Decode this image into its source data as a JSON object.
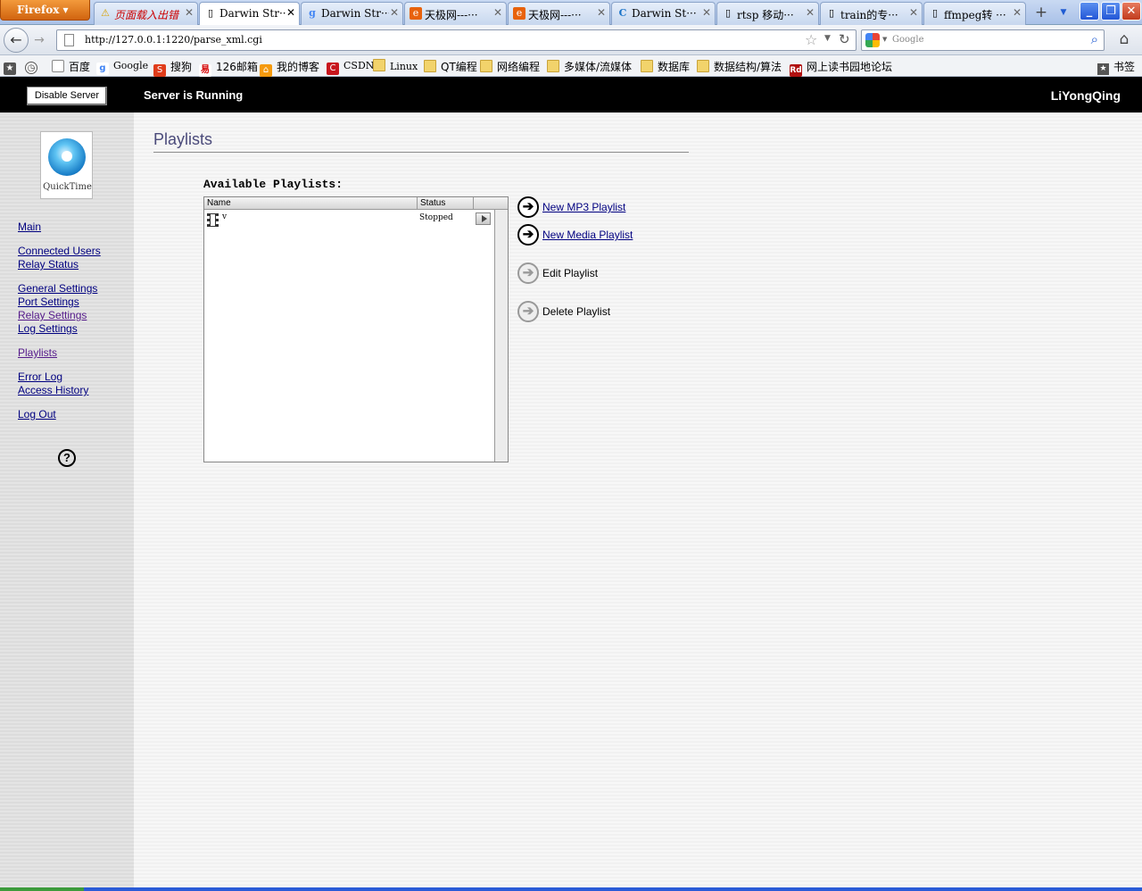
{
  "browser": {
    "menu_button": "Firefox",
    "tabs": [
      {
        "label": "页面载入出错",
        "icon": "warning-icon",
        "active": false
      },
      {
        "label": "Darwin Str···",
        "icon": "page-icon",
        "active": true
      },
      {
        "label": "Darwin Str···",
        "icon": "google-icon",
        "active": false
      },
      {
        "label": "天极网---···",
        "icon": "yesky-icon",
        "active": false
      },
      {
        "label": "天极网---···",
        "icon": "yesky-icon",
        "active": false
      },
      {
        "label": "Darwin  St···",
        "icon": "c-icon",
        "active": false
      },
      {
        "label": "rtsp 移动···",
        "icon": "page-icon",
        "active": false
      },
      {
        "label": "train的专···",
        "icon": "page-icon",
        "active": false
      },
      {
        "label": "ffmpeg转 ···",
        "icon": "page-icon",
        "active": false
      }
    ],
    "url": "http://127.0.0.1:1220/parse_xml.cgi",
    "search_placeholder": "Google",
    "bookmarks": [
      {
        "label": "百度",
        "icon": "page-icon"
      },
      {
        "label": "Google",
        "icon": "google-icon"
      },
      {
        "label": "搜狗",
        "icon": "sogou-icon"
      },
      {
        "label": "126邮箱",
        "icon": "mail-icon"
      },
      {
        "label": "我的博客",
        "icon": "blog-icon"
      },
      {
        "label": "CSDN",
        "icon": "csdn-icon"
      },
      {
        "label": "Linux",
        "icon": "folder-icon"
      },
      {
        "label": "QT编程",
        "icon": "folder-icon"
      },
      {
        "label": "网络编程",
        "icon": "folder-icon"
      },
      {
        "label": "多媒体/流媒体",
        "icon": "folder-icon"
      },
      {
        "label": "数据库",
        "icon": "folder-icon"
      },
      {
        "label": "数据结构/算法",
        "icon": "folder-icon"
      },
      {
        "label": "网上读书园地论坛",
        "icon": "rd-icon"
      }
    ],
    "bookmarks_menu": "书签"
  },
  "header": {
    "disable_button": "Disable Server",
    "status": "Server is Running",
    "user": "LiYongQing"
  },
  "sidebar": {
    "logo_text": "QuickTime",
    "nav": [
      {
        "label": "Main",
        "visited": false
      },
      {
        "label": "Connected Users",
        "visited": false
      },
      {
        "label": "Relay Status",
        "visited": false
      },
      {
        "label": "General Settings",
        "visited": false
      },
      {
        "label": "Port Settings",
        "visited": false
      },
      {
        "label": "Relay Settings",
        "visited": true
      },
      {
        "label": "Log Settings",
        "visited": false
      },
      {
        "label": "Playlists",
        "visited": true
      },
      {
        "label": "Error Log",
        "visited": false
      },
      {
        "label": "Access History",
        "visited": false
      },
      {
        "label": "Log Out",
        "visited": false
      }
    ],
    "help_icon": "?"
  },
  "main": {
    "title": "Playlists",
    "available_label": "Available Playlists:",
    "table": {
      "columns": [
        "Name",
        "Status"
      ],
      "rows": [
        {
          "name": "v",
          "status": "Stopped"
        }
      ]
    },
    "actions": [
      {
        "label": "New MP3 Playlist",
        "enabled": true
      },
      {
        "label": "New Media Playlist",
        "enabled": true
      },
      {
        "label": "Edit Playlist",
        "enabled": false
      },
      {
        "label": "Delete Playlist",
        "enabled": false
      }
    ]
  }
}
